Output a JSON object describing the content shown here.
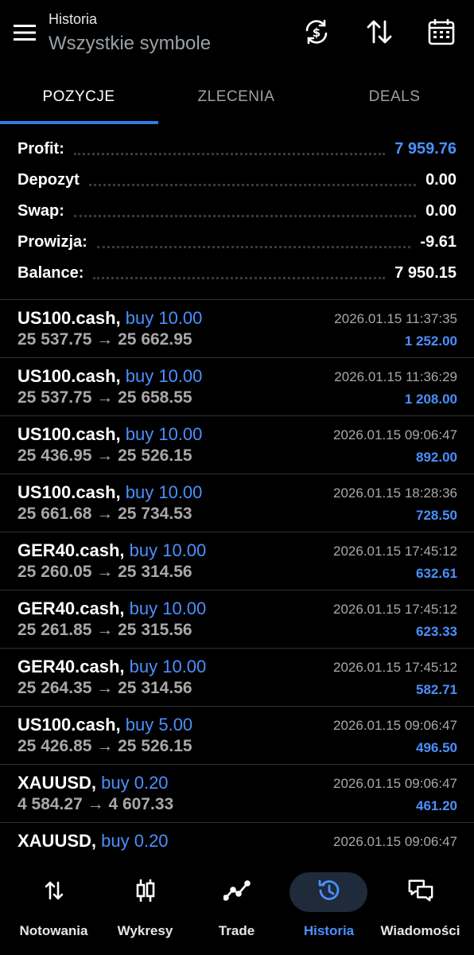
{
  "header": {
    "subtitle": "Historia",
    "title": "Wszystkie symbole",
    "icons": [
      "menu-icon",
      "currency-exchange-icon",
      "sort-icon",
      "calendar-icon"
    ]
  },
  "tabs": [
    {
      "label": "POZYCJE",
      "active": true
    },
    {
      "label": "ZLECENIA",
      "active": false
    },
    {
      "label": "DEALS",
      "active": false
    }
  ],
  "summary": {
    "profit": {
      "label": "Profit:",
      "value": "7 959.76"
    },
    "deposit": {
      "label": "Depozyt",
      "value": "0.00"
    },
    "swap": {
      "label": "Swap:",
      "value": "0.00"
    },
    "commission": {
      "label": "Prowizja:",
      "value": "-9.61"
    },
    "balance": {
      "label": "Balance:",
      "value": "7 950.15"
    }
  },
  "trades": [
    {
      "symbol": "US100.cash,",
      "side": "buy 10.00",
      "open": "25 537.75",
      "close": "25 662.95",
      "time": "2026.01.15 11:37:35",
      "profit": "1 252.00"
    },
    {
      "symbol": "US100.cash,",
      "side": "buy 10.00",
      "open": "25 537.75",
      "close": "25 658.55",
      "time": "2026.01.15 11:36:29",
      "profit": "1 208.00"
    },
    {
      "symbol": "US100.cash,",
      "side": "buy 10.00",
      "open": "25 436.95",
      "close": "25 526.15",
      "time": "2026.01.15 09:06:47",
      "profit": "892.00"
    },
    {
      "symbol": "US100.cash,",
      "side": "buy 10.00",
      "open": "25 661.68",
      "close": "25 734.53",
      "time": "2026.01.15 18:28:36",
      "profit": "728.50"
    },
    {
      "symbol": "GER40.cash,",
      "side": "buy 10.00",
      "open": "25 260.05",
      "close": "25 314.56",
      "time": "2026.01.15 17:45:12",
      "profit": "632.61"
    },
    {
      "symbol": "GER40.cash,",
      "side": "buy 10.00",
      "open": "25 261.85",
      "close": "25 315.56",
      "time": "2026.01.15 17:45:12",
      "profit": "623.33"
    },
    {
      "symbol": "GER40.cash,",
      "side": "buy 10.00",
      "open": "25 264.35",
      "close": "25 314.56",
      "time": "2026.01.15 17:45:12",
      "profit": "582.71"
    },
    {
      "symbol": "US100.cash,",
      "side": "buy 5.00",
      "open": "25 426.85",
      "close": "25 526.15",
      "time": "2026.01.15 09:06:47",
      "profit": "496.50"
    },
    {
      "symbol": "XAUUSD,",
      "side": "buy 0.20",
      "open": "4 584.27",
      "close": "4 607.33",
      "time": "2026.01.15 09:06:47",
      "profit": "461.20"
    },
    {
      "symbol": "XAUUSD,",
      "side": "buy 0.20",
      "open": "",
      "close": "",
      "time": "2026.01.15 09:06:47",
      "profit": ""
    }
  ],
  "arrow": "→",
  "nav": [
    {
      "label": "Notowania",
      "icon": "quotes-icon",
      "active": false
    },
    {
      "label": "Wykresy",
      "icon": "candlestick-chart-icon",
      "active": false
    },
    {
      "label": "Trade",
      "icon": "trade-line-icon",
      "active": false
    },
    {
      "label": "Historia",
      "icon": "history-icon",
      "active": true
    },
    {
      "label": "Wiadomości",
      "icon": "messages-icon",
      "active": false
    }
  ],
  "colors": {
    "accent": "#4a90ff",
    "indicator": "#2f7de1",
    "background": "#000000",
    "muted": "#a8a8a8"
  }
}
